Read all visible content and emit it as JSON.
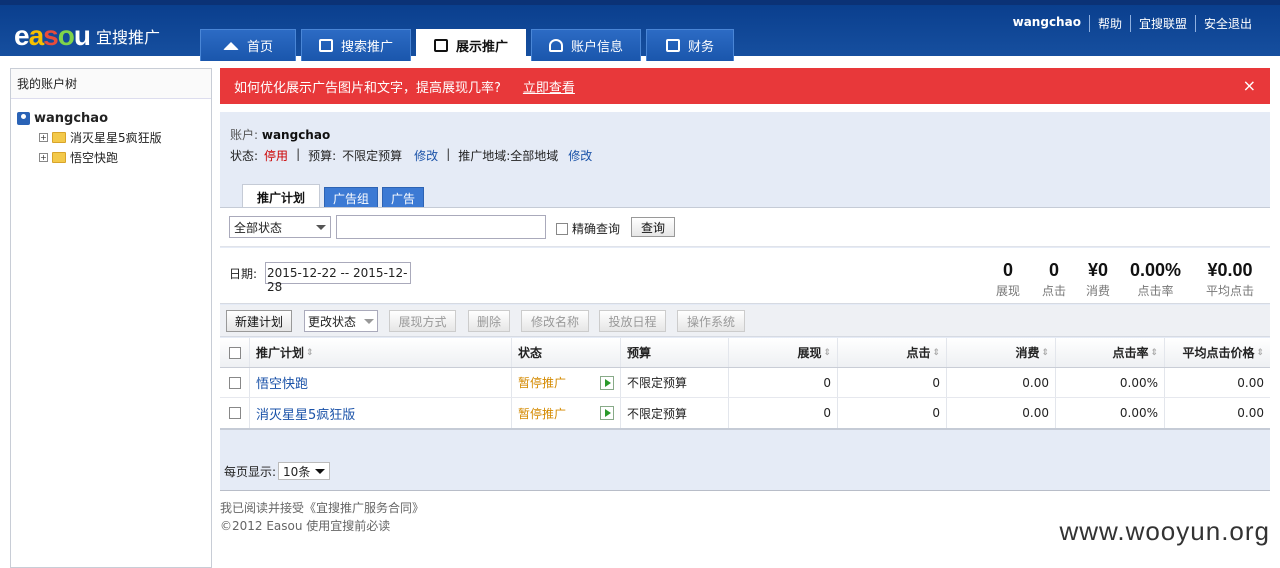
{
  "header": {
    "logo_mark": "easou",
    "logo_text": "宜搜推广",
    "nav": [
      {
        "label": "首页",
        "icon": "home-icon"
      },
      {
        "label": "搜索推广",
        "icon": "edit-icon"
      },
      {
        "label": "展示推广",
        "icon": "image-icon",
        "active": true
      },
      {
        "label": "账户信息",
        "icon": "user-icon"
      },
      {
        "label": "财务",
        "icon": "money-icon"
      }
    ],
    "user": "wangchao",
    "links": [
      "帮助",
      "宜搜联盟",
      "安全退出"
    ]
  },
  "sidebar": {
    "title": "我的账户树",
    "root": "wangchao",
    "nodes": [
      "消灭星星5疯狂版",
      "悟空快跑"
    ]
  },
  "alert": {
    "text": "如何优化展示广告图片和文字，提高展现几率?",
    "link": "立即查看",
    "close": "×"
  },
  "account": {
    "label": "账户:",
    "name": "wangchao",
    "status_label": "状态:",
    "status": "停用",
    "budget_label": "预算:",
    "budget": "不限定预算",
    "edit": "修改",
    "region_label": "推广地域:",
    "region": "全部地域"
  },
  "subtabs": [
    "推广计划",
    "广告组",
    "广告"
  ],
  "search": {
    "status_select": "全部状态",
    "keyword": "",
    "exact_label": "精确查询",
    "query_btn": "查询"
  },
  "date": {
    "label": "日期:",
    "range": "2015-12-22 -- 2015-12-28"
  },
  "stats": [
    {
      "value": "0",
      "label": "展现"
    },
    {
      "value": "0",
      "label": "点击"
    },
    {
      "value": "¥0",
      "label": "消费"
    },
    {
      "value": "0.00%",
      "label": "点击率"
    },
    {
      "value": "¥0.00",
      "label": "平均点击"
    }
  ],
  "toolbar": {
    "new_plan": "新建计划",
    "change_status": "更改状态",
    "display_mode": "展现方式",
    "delete": "删除",
    "rename": "修改名称",
    "schedule": "投放日程",
    "os": "操作系统"
  },
  "table": {
    "columns": [
      "推广计划",
      "状态",
      "预算",
      "展现",
      "点击",
      "消费",
      "点击率",
      "平均点击价格"
    ],
    "rows": [
      {
        "name": "悟空快跑",
        "status": "暂停推广",
        "budget": "不限定预算",
        "impressions": "0",
        "clicks": "0",
        "cost": "0.00",
        "ctr": "0.00%",
        "cpc": "0.00"
      },
      {
        "name": "消灭星星5疯狂版",
        "status": "暂停推广",
        "budget": "不限定预算",
        "impressions": "0",
        "clicks": "0",
        "cost": "0.00",
        "ctr": "0.00%",
        "cpc": "0.00"
      }
    ]
  },
  "pager": {
    "label": "每页显示:",
    "value": "10条"
  },
  "footer": {
    "line1": "我已阅读并接受《宜搜推广服务合同》",
    "line2": "©2012 Easou 使用宜搜前必读"
  },
  "watermark": "www.wooyun.org"
}
